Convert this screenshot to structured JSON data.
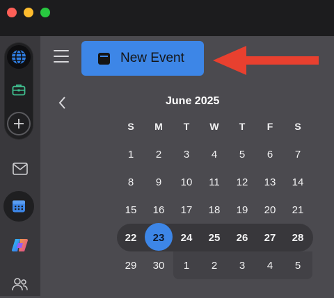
{
  "window": {
    "traffic_lights": [
      "close",
      "minimize",
      "zoom"
    ],
    "colors": {
      "close": "#fe5f57",
      "minimize": "#febc2e",
      "zoom": "#28c840"
    }
  },
  "rail": {
    "items": [
      {
        "icon": "globe-icon"
      },
      {
        "icon": "briefcase-icon"
      },
      {
        "icon": "plus-icon"
      },
      {
        "icon": "mail-icon"
      },
      {
        "icon": "calendar-icon",
        "active": true
      },
      {
        "icon": "copilot-icon"
      },
      {
        "icon": "people-icon"
      }
    ]
  },
  "toolbar": {
    "new_event_label": "New Event",
    "accent": "#3d86e7"
  },
  "calendar": {
    "month_label": "June 2025",
    "weekdays": [
      "S",
      "M",
      "T",
      "W",
      "T",
      "F",
      "S"
    ],
    "weeks": [
      [
        "1",
        "2",
        "3",
        "4",
        "5",
        "6",
        "7"
      ],
      [
        "8",
        "9",
        "10",
        "11",
        "12",
        "13",
        "14"
      ],
      [
        "15",
        "16",
        "17",
        "18",
        "19",
        "20",
        "21"
      ],
      [
        "22",
        "23",
        "24",
        "25",
        "26",
        "27",
        "28"
      ],
      [
        "29",
        "30",
        "1",
        "2",
        "3",
        "4",
        "5"
      ]
    ],
    "today": "23",
    "selected_week_index": 3
  }
}
